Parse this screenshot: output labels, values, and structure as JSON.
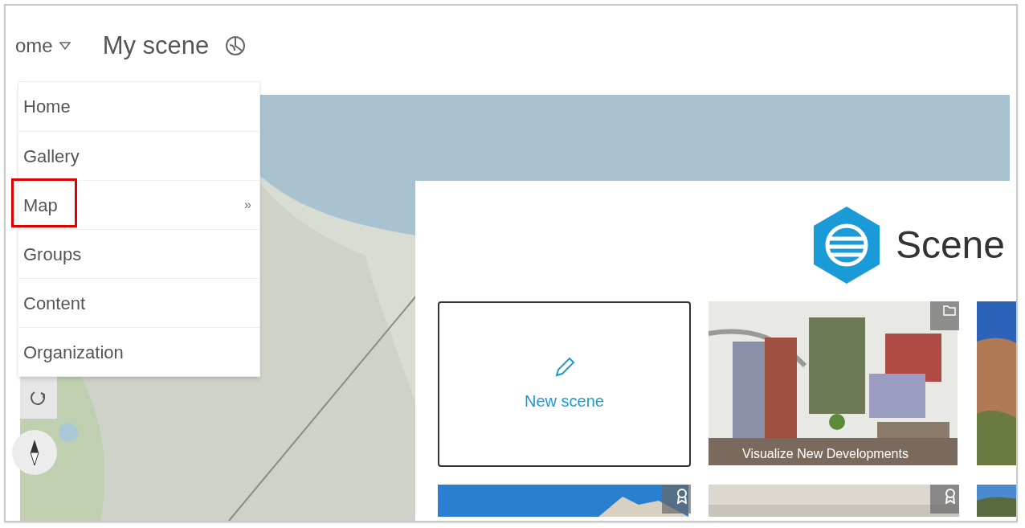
{
  "header": {
    "nav_label": "ome",
    "title": "My scene"
  },
  "nav_menu": {
    "items": [
      {
        "label": "Home",
        "highlighted": false
      },
      {
        "label": "Gallery",
        "highlighted": false
      },
      {
        "label": "Map",
        "highlighted": true,
        "submenu_mark": "»"
      },
      {
        "label": "Groups",
        "highlighted": false
      },
      {
        "label": "Content",
        "highlighted": false
      },
      {
        "label": "Organization",
        "highlighted": false
      }
    ]
  },
  "map": {
    "kind": "picture"
  },
  "scene_panel": {
    "app_name": "Scene",
    "cards": [
      {
        "kind": "new",
        "label": "New scene"
      },
      {
        "kind": "picture",
        "caption": "Visualize New Developments",
        "badge": {
          "kind": "folder"
        }
      },
      {
        "kind": "picture"
      },
      {
        "kind": "picture",
        "badge": {
          "kind": "award"
        }
      },
      {
        "kind": "picture",
        "badge": {
          "kind": "award"
        }
      },
      {
        "kind": "picture"
      }
    ]
  }
}
